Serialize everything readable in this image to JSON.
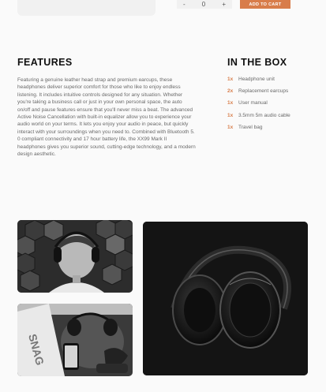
{
  "product": {
    "quantity_decrement": "-",
    "quantity_value": "0",
    "quantity_increment": "+",
    "add_to_cart_label": "ADD TO CART"
  },
  "features": {
    "title": "FEATURES",
    "body": "Featuring a genuine leather head strap and premium earcups, these headphones deliver superior comfort for those who like to enjoy endless listening. It includes intuitive controls designed for any situation. Whether you're taking a business call or just in your own personal space, the auto on/off and pause features ensure that you'll never miss a beat. The advanced Active Noise Cancellation with built-in equalizer allow you to experience your audio world on your terms. It lets you enjoy your audio in peace, but quickly interact with your surroundings when you need to. Combined with Bluetooth 5. 0 compliant connectivity and 17 hour battery life, the XX99 Mark II headphones gives you superior sound, cutting-edge technology, and a modern design aesthetic."
  },
  "in_the_box": {
    "title": "IN THE BOX",
    "items": [
      {
        "qty": "1x",
        "name": "Headphone unit"
      },
      {
        "qty": "2x",
        "name": "Replacement earcups"
      },
      {
        "qty": "1x",
        "name": "User manual"
      },
      {
        "qty": "1x",
        "name": "3.5mm 5m audio cable"
      },
      {
        "qty": "1x",
        "name": "Travel bag"
      }
    ]
  },
  "gallery": {
    "photo_2_text": "SNAG"
  },
  "colors": {
    "accent": "#d87d4a",
    "heading": "#101010",
    "body_text": "#6a6a6a",
    "background": "#fafafa"
  }
}
